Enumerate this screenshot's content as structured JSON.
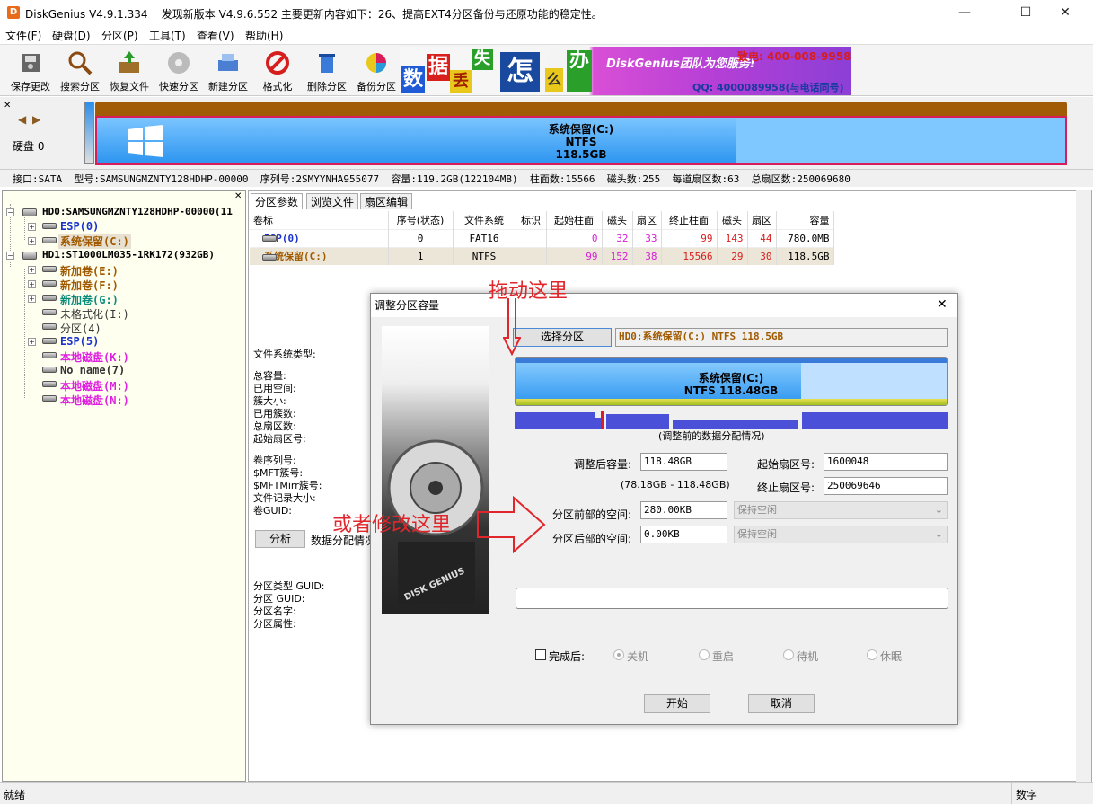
{
  "window": {
    "title": "DiskGenius V4.9.1.334",
    "update_notice": "发现新版本 V4.9.6.552 主要更新内容如下：26、提高EXT4分区备份与还原功能的稳定性。",
    "min_glyph": "—",
    "max_glyph": "☐",
    "close_glyph": "✕"
  },
  "menu": [
    "文件(F)",
    "硬盘(D)",
    "分区(P)",
    "工具(T)",
    "查看(V)",
    "帮助(H)"
  ],
  "toolbar": [
    "保存更改",
    "搜索分区",
    "恢复文件",
    "快速分区",
    "新建分区",
    "格式化",
    "删除分区",
    "备份分区"
  ],
  "ad": {
    "chars": [
      "数",
      "据",
      "丢",
      "失",
      "怎",
      "么",
      "办",
      "!"
    ],
    "team_text": "DiskGenius团队为您服务!",
    "phone": "致电: 400-008-9958",
    "qq": "QQ: 4000089958(与电话同号)"
  },
  "diskbar": {
    "disk_label": "硬盘 0",
    "partition_name": "系统保留(C:)",
    "partition_fs": "NTFS",
    "partition_size": "118.5GB"
  },
  "diskinfo": "接口:SATA  型号:SAMSUNGMZNTY128HDHP-00000  序列号:2SMYYNHA955077  容量:119.2GB(122104MB)  柱面数:15566  磁头数:255  每道扇区数:63  总扇区数:250069680",
  "tree": {
    "hd0": "HD0:SAMSUNGMZNTY128HDHP-00000(11",
    "hd0_items": [
      {
        "label": "ESP(0)",
        "color": "#1a33cc"
      },
      {
        "label": "系统保留(C:)",
        "color": "#a05a00"
      }
    ],
    "hd1": "HD1:ST1000LM035-1RK172(932GB)",
    "hd1_items": [
      {
        "label": "新加卷(E:)",
        "color": "#a05a00"
      },
      {
        "label": "新加卷(F:)",
        "color": "#a05a00"
      },
      {
        "label": "新加卷(G:)",
        "color": "#0a8c7a"
      },
      {
        "label": "未格式化(I:)",
        "color": "#333333"
      },
      {
        "label": "分区(4)",
        "color": "#333333"
      },
      {
        "label": "ESP(5)",
        "color": "#1a33cc"
      },
      {
        "label": "本地磁盘(K:)",
        "color": "#e020e0"
      },
      {
        "label": "No name(7)",
        "color": "#333333"
      },
      {
        "label": "本地磁盘(M:)",
        "color": "#e020e0"
      },
      {
        "label": "本地磁盘(N:)",
        "color": "#e020e0"
      }
    ]
  },
  "tabs": [
    "分区参数",
    "浏览文件",
    "扇区编辑"
  ],
  "table": {
    "headers": [
      "卷标",
      "序号(状态)",
      "文件系统",
      "标识",
      "起始柱面",
      "磁头",
      "扇区",
      "终止柱面",
      "磁头",
      "扇区",
      "容量"
    ],
    "rows": [
      [
        "ESP(0)",
        "0",
        "FAT16",
        "",
        "0",
        "32",
        "33",
        "99",
        "143",
        "44",
        "780.0MB"
      ],
      [
        "系统保留(C:)",
        "1",
        "NTFS",
        "",
        "99",
        "152",
        "38",
        "15566",
        "29",
        "30",
        "118.5GB"
      ]
    ]
  },
  "detail_labels": {
    "fs_type": "文件系统类型:",
    "group1": [
      "总容量:",
      "已用空间:",
      "簇大小:",
      "已用簇数:",
      "总扇区数:",
      "起始扇区号:"
    ],
    "group2": [
      "卷序列号:",
      "$MFT簇号:",
      "$MFTMirr簇号:",
      "文件记录大小:",
      "卷GUID:"
    ],
    "analyze_btn": "分析",
    "alloc_label": "数据分配情况",
    "group3": [
      "分区类型 GUID:",
      "分区 GUID:",
      "分区名字:",
      "分区属性:"
    ]
  },
  "status": {
    "left": "就绪",
    "right": "数字"
  },
  "dialog": {
    "title": "调整分区容量",
    "select_btn": "选择分区",
    "selected_partition": "HD0:系统保留(C:) NTFS 118.5GB",
    "bar_name": "系统保留(C:)",
    "bar_info": "NTFS 118.48GB",
    "alloc_caption": "(调整前的数据分配情况)",
    "size_after_label": "调整后容量:",
    "size_after": "118.48GB",
    "range": "(78.18GB - 118.48GB)",
    "start_sector_label": "起始扇区号:",
    "start_sector": "1600048",
    "end_sector_label": "终止扇区号:",
    "end_sector": "250069646",
    "before_label": "分区前部的空间:",
    "before_value": "280.00KB",
    "before_action": "保持空闲",
    "after_label": "分区后部的空间:",
    "after_value": "0.00KB",
    "after_action": "保持空闲",
    "finish_label": "完成后:",
    "options": [
      "关机",
      "重启",
      "待机",
      "休眠"
    ],
    "start_btn": "开始",
    "cancel_btn": "取消"
  },
  "annotations": {
    "drag": "拖动这里",
    "or_edit": "或者修改这里"
  }
}
